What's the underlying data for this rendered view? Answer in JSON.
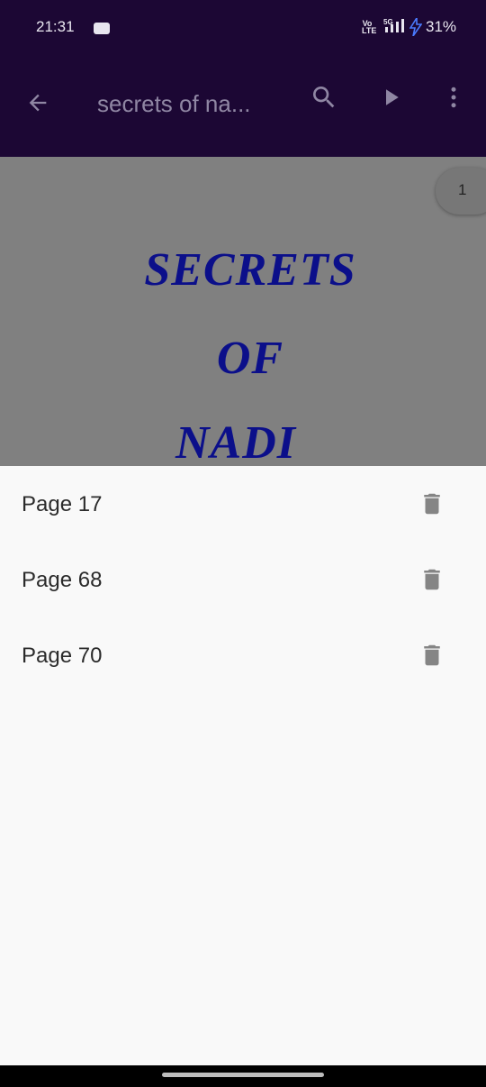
{
  "status_bar": {
    "time": "21:31",
    "network_label": "Vo\nLTE",
    "signal_label": "5G",
    "battery": "31%"
  },
  "app_bar": {
    "title": "secrets of na...",
    "back_icon": "arrow-back-icon",
    "search_icon": "search-icon",
    "play_icon": "play-icon",
    "more_icon": "more-vert-icon"
  },
  "document": {
    "lines": [
      "SECRETS",
      "OF",
      "NADI"
    ],
    "current_page": "1"
  },
  "bookmarks": {
    "items": [
      {
        "label": "Page 17"
      },
      {
        "label": "Page 68"
      },
      {
        "label": "Page 70"
      }
    ],
    "delete_icon": "delete-icon"
  },
  "colors": {
    "app_bar_bg": "#1c0734",
    "title_text": "#8f86a3",
    "doc_title": "#0b0f8a",
    "sheet_bg": "#f9f9f9",
    "icon_grey": "#858585"
  }
}
